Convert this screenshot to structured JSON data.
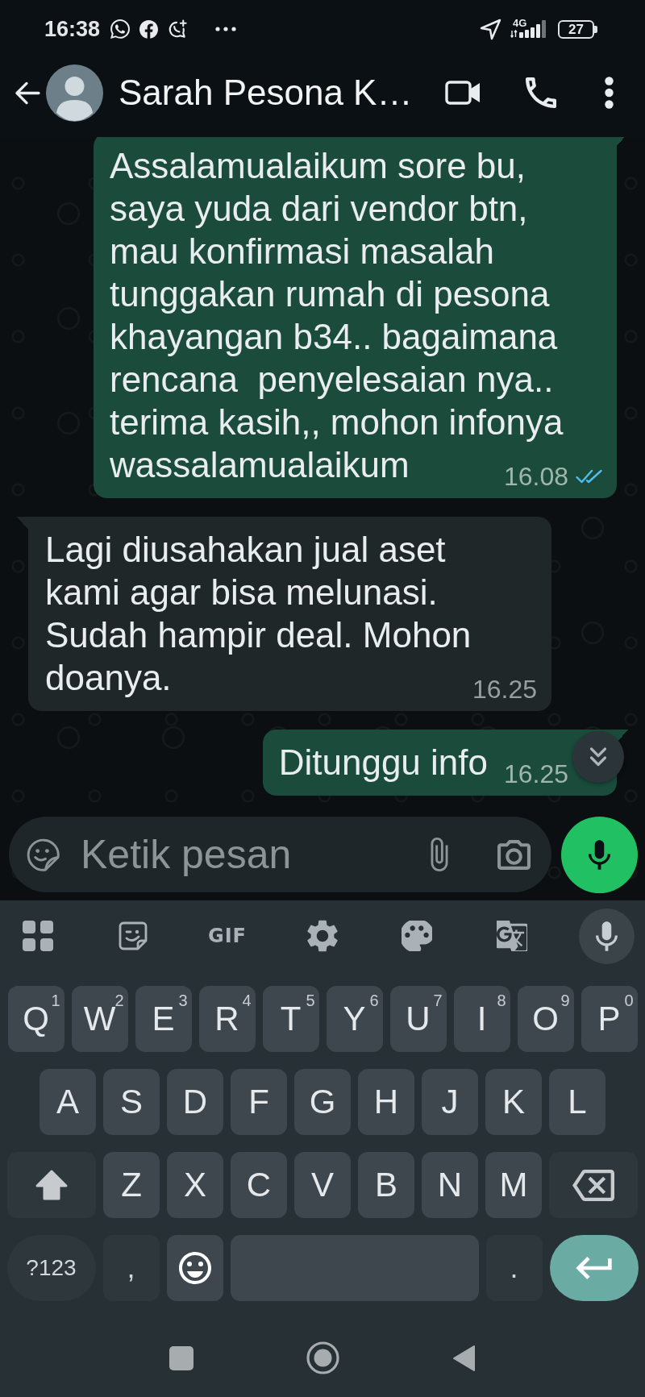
{
  "status_bar": {
    "time": "16:38",
    "network": "4G",
    "battery": "27"
  },
  "header": {
    "contact_name": "Sarah Pesona K…"
  },
  "messages": [
    {
      "kind": "outgoing",
      "text": "Assalamualaikum sore bu,\nsaya yuda dari vendor btn,\nmau konfirmasi masalah\ntunggakan rumah di pesona\nkhayangan b34.. bagaimana\nrencana  penyelesaian nya..\nterima kasih,, mohon infonya\nwassalamualaikum",
      "time": "16.08",
      "read": true
    },
    {
      "kind": "incoming",
      "text": "Lagi diusahakan jual aset\nkami agar bisa melunasi.\nSudah hampir deal. Mohon\ndoanya.",
      "time": "16.25"
    },
    {
      "kind": "outgoing",
      "text": "Ditunggu info",
      "time": "16.25"
    }
  ],
  "composer": {
    "placeholder": "Ketik pesan"
  },
  "keyboard": {
    "toolbar": {
      "gif_label": "GIF"
    },
    "rows": [
      {
        "keys": [
          {
            "kind": "letter",
            "label": "Q",
            "hint": "1"
          },
          {
            "kind": "letter",
            "label": "W",
            "hint": "2"
          },
          {
            "kind": "letter",
            "label": "E",
            "hint": "3"
          },
          {
            "kind": "letter",
            "label": "R",
            "hint": "4"
          },
          {
            "kind": "letter",
            "label": "T",
            "hint": "5"
          },
          {
            "kind": "letter",
            "label": "Y",
            "hint": "6"
          },
          {
            "kind": "letter",
            "label": "U",
            "hint": "7"
          },
          {
            "kind": "letter",
            "label": "I",
            "hint": "8"
          },
          {
            "kind": "letter",
            "label": "O",
            "hint": "9"
          },
          {
            "kind": "letter",
            "label": "P",
            "hint": "0"
          }
        ]
      },
      {
        "keys": [
          {
            "kind": "letter",
            "label": "A"
          },
          {
            "kind": "letter",
            "label": "S"
          },
          {
            "kind": "letter",
            "label": "D"
          },
          {
            "kind": "letter",
            "label": "F"
          },
          {
            "kind": "letter",
            "label": "G"
          },
          {
            "kind": "letter",
            "label": "H"
          },
          {
            "kind": "letter",
            "label": "J"
          },
          {
            "kind": "letter",
            "label": "K"
          },
          {
            "kind": "letter",
            "label": "L"
          }
        ]
      },
      {
        "keys": [
          {
            "kind": "shift",
            "on": true
          },
          {
            "kind": "letter",
            "label": "Z"
          },
          {
            "kind": "letter",
            "label": "X"
          },
          {
            "kind": "letter",
            "label": "C"
          },
          {
            "kind": "letter",
            "label": "V"
          },
          {
            "kind": "letter",
            "label": "B"
          },
          {
            "kind": "letter",
            "label": "N"
          },
          {
            "kind": "letter",
            "label": "M"
          },
          {
            "kind": "backspace"
          }
        ]
      },
      {
        "keys": [
          {
            "kind": "symbols",
            "label": "?123"
          },
          {
            "kind": "punctuation",
            "label": ","
          },
          {
            "kind": "emoji"
          },
          {
            "kind": "space"
          },
          {
            "kind": "punctuation",
            "label": "."
          },
          {
            "kind": "enter"
          }
        ]
      }
    ]
  }
}
